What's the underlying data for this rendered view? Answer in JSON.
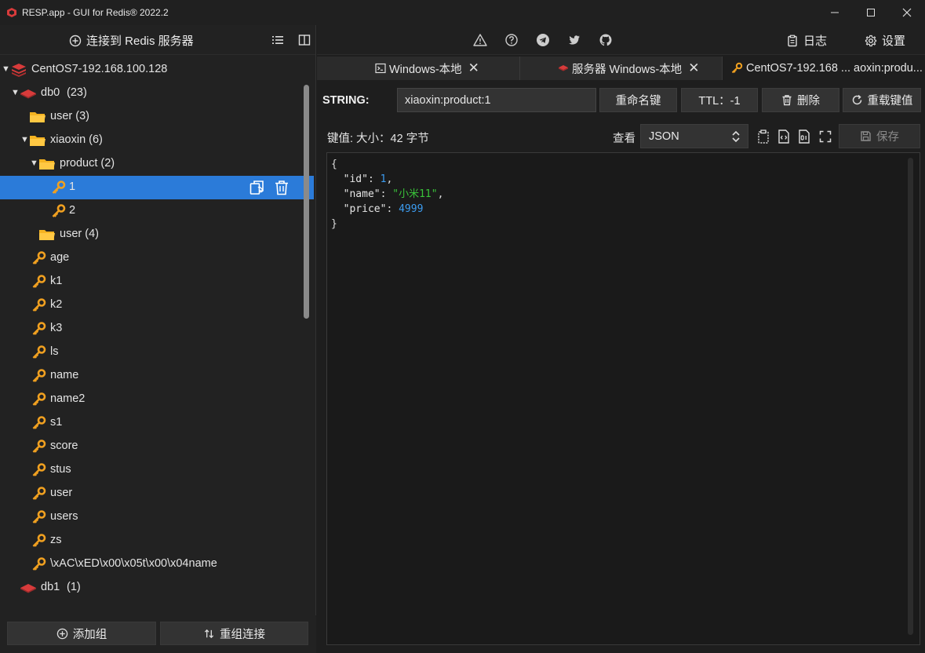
{
  "window": {
    "title": "RESP.app - GUI for Redis® 2022.2",
    "controls": [
      "minimize",
      "maximize",
      "close"
    ]
  },
  "sidebar": {
    "connect_label": "连接到 Redis 服务器",
    "tree": [
      {
        "label": "CentOS7-192.168.100.128",
        "type": "server",
        "depth": 0,
        "expanded": true
      },
      {
        "label": "db0",
        "count": "(23)",
        "type": "db",
        "depth": 1,
        "expanded": true
      },
      {
        "label": "user (3)",
        "type": "folder",
        "depth": 2,
        "expanded": false
      },
      {
        "label": "xiaoxin (6)",
        "type": "folder",
        "depth": 2,
        "expanded": true
      },
      {
        "label": "product (2)",
        "type": "folder",
        "depth": 3,
        "expanded": true
      },
      {
        "label": "1",
        "type": "key",
        "depth": 4,
        "selected": true
      },
      {
        "label": "2",
        "type": "key",
        "depth": 4
      },
      {
        "label": "user (4)",
        "type": "folder",
        "depth": 3,
        "expanded": false
      },
      {
        "label": "age",
        "type": "key",
        "depth": 2
      },
      {
        "label": "k1",
        "type": "key",
        "depth": 2
      },
      {
        "label": "k2",
        "type": "key",
        "depth": 2
      },
      {
        "label": "k3",
        "type": "key",
        "depth": 2
      },
      {
        "label": "ls",
        "type": "key",
        "depth": 2
      },
      {
        "label": "name",
        "type": "key",
        "depth": 2
      },
      {
        "label": "name2",
        "type": "key",
        "depth": 2
      },
      {
        "label": "s1",
        "type": "key",
        "depth": 2
      },
      {
        "label": "score",
        "type": "key",
        "depth": 2
      },
      {
        "label": "stus",
        "type": "key",
        "depth": 2
      },
      {
        "label": "user",
        "type": "key",
        "depth": 2
      },
      {
        "label": "users",
        "type": "key",
        "depth": 2
      },
      {
        "label": "zs",
        "type": "key",
        "depth": 2
      },
      {
        "label": "\\xAC\\xED\\x00\\x05t\\x00\\x04name",
        "type": "key",
        "depth": 2
      },
      {
        "label": "db1",
        "count": "(1)",
        "type": "db",
        "depth": 1,
        "expanded": false
      }
    ],
    "footer": {
      "add_group": "添加组",
      "reorder": "重组连接"
    }
  },
  "toolbar": {
    "log_label": "日志",
    "settings_label": "设置"
  },
  "tabs": [
    {
      "label": "Windows-本地",
      "icon": "terminal-icon"
    },
    {
      "label": "服务器 Windows-本地",
      "icon": "redis-db-icon"
    },
    {
      "label": "CentOS7-192.168 ... aoxin:produ...",
      "icon": "key-icon",
      "active": true
    }
  ],
  "key_panel": {
    "type_label": "STRING:",
    "key_name": "xiaoxin:product:1",
    "rename_label": "重命名键",
    "ttl_label": "TTL：-1",
    "delete_label": "删除",
    "reload_label": "重载键值",
    "size_label": "键值: 大小：42 字节",
    "view_label": "查看",
    "view_mode": "JSON",
    "save_label": "保存"
  },
  "value": {
    "open": "{",
    "fields": [
      {
        "key": "\"id\"",
        "value": "1",
        "kind": "number",
        "comma": ","
      },
      {
        "key": "\"name\"",
        "value": "\"小米11\"",
        "kind": "string",
        "comma": ","
      },
      {
        "key": "\"price\"",
        "value": "4999",
        "kind": "number",
        "comma": ""
      }
    ],
    "close": "}"
  },
  "colors": {
    "selection": "#2b7bd9",
    "key_icon": "#f0a020",
    "folder_icon": "#f5b321",
    "redis_red": "#d83b3b",
    "json_number": "#3c9cf0",
    "json_string": "#39c239"
  }
}
